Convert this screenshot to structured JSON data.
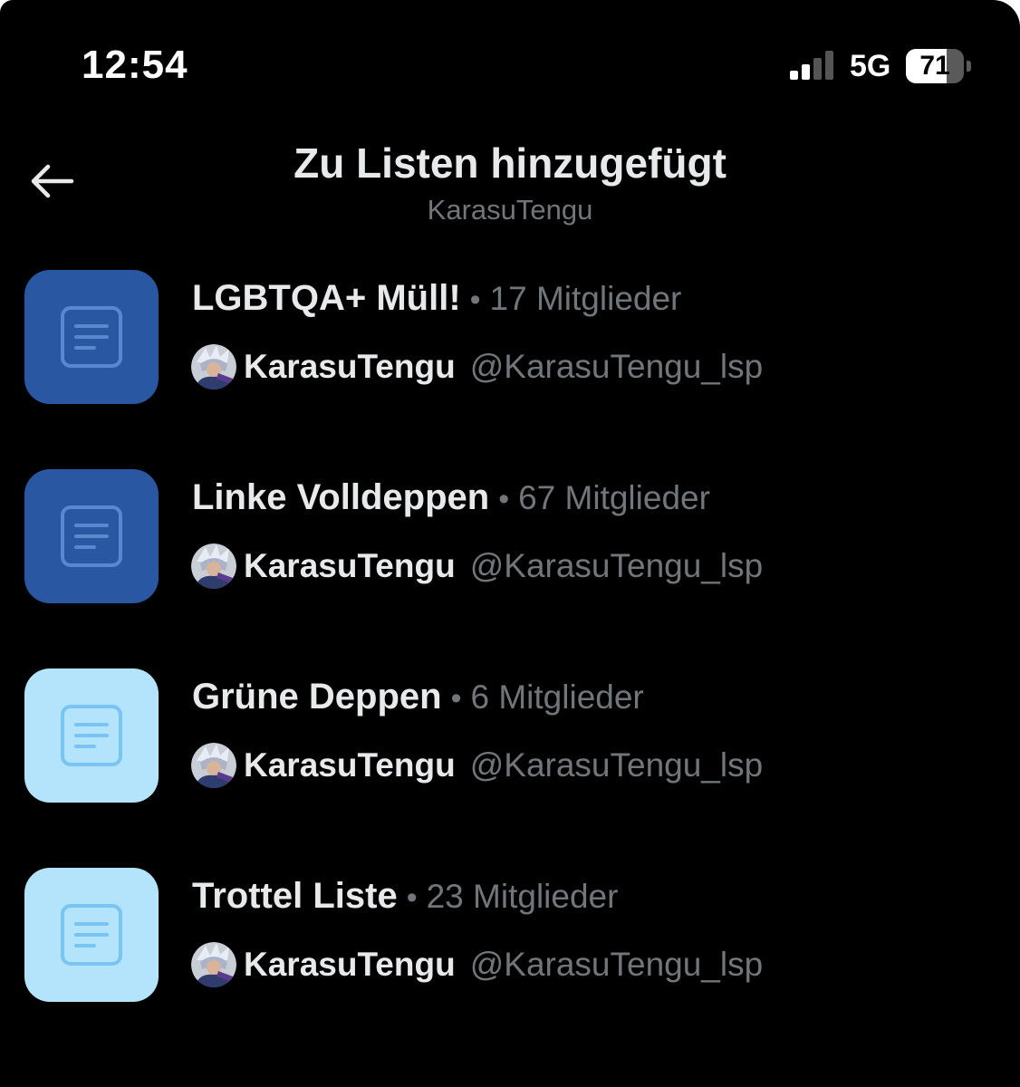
{
  "status_bar": {
    "time": "12:54",
    "network": "5G",
    "battery_level": "71",
    "battery_fraction": 0.71,
    "signal_bars_active": 2,
    "signal_bars_total": 4
  },
  "header": {
    "back_icon": "arrow-left-icon",
    "title": "Zu Listen hinzugefügt",
    "subtitle": "KarasuTengu"
  },
  "colors": {
    "background": "#000000",
    "primary_text": "#e7e9ea",
    "secondary_text": "#71767b",
    "thumb_dark": "#2a57a1",
    "thumb_dark_icon": "#5a88cf",
    "thumb_light": "#b4e3fc",
    "thumb_light_icon": "#79c4f3"
  },
  "lists": [
    {
      "name": "LGBTQA+ Müll!",
      "separator": "•",
      "members": "17 Mitglieder",
      "owner_name": "KarasuTengu",
      "owner_handle": "@KarasuTengu_lsp",
      "thumb_style": "dark",
      "thumb_icon": "list-document-icon"
    },
    {
      "name": "Linke Volldeppen",
      "separator": "•",
      "members": "67 Mitglieder",
      "owner_name": "KarasuTengu",
      "owner_handle": "@KarasuTengu_lsp",
      "thumb_style": "dark",
      "thumb_icon": "list-document-icon"
    },
    {
      "name": "Grüne Deppen",
      "separator": "•",
      "members": "6 Mitglieder",
      "owner_name": "KarasuTengu",
      "owner_handle": "@KarasuTengu_lsp",
      "thumb_style": "light",
      "thumb_icon": "list-document-icon"
    },
    {
      "name": "Trottel Liste",
      "separator": "•",
      "members": "23 Mitglieder",
      "owner_name": "KarasuTengu",
      "owner_handle": "@KarasuTengu_lsp",
      "thumb_style": "light",
      "thumb_icon": "list-document-icon"
    }
  ]
}
